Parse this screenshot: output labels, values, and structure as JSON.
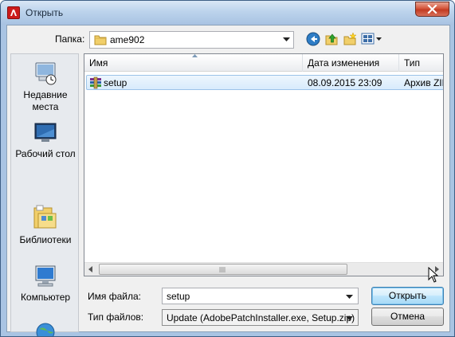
{
  "window": {
    "title": "Открыть"
  },
  "toolbar": {
    "folder_label": "Папка:",
    "current_folder": "ame902"
  },
  "places": [
    {
      "label_lines": [
        "Недавние",
        "места"
      ],
      "icon": "recent-places-icon"
    },
    {
      "label_lines": [
        "Рабочий стол"
      ],
      "icon": "desktop-icon"
    },
    {
      "label_lines": [
        "Библиотеки"
      ],
      "icon": "libraries-icon"
    },
    {
      "label_lines": [
        "Компьютер"
      ],
      "icon": "computer-icon"
    },
    {
      "label_lines": [
        ""
      ],
      "icon": "network-icon"
    }
  ],
  "filelist": {
    "columns": [
      "Имя",
      "Дата изменения",
      "Тип"
    ],
    "rows": [
      {
        "name": "setup",
        "date": "08.09.2015 23:09",
        "type": "Архив ZIP",
        "icon": "winrar-archive-icon"
      }
    ]
  },
  "bottom": {
    "filename_label": "Имя файла:",
    "filename_value": "setup",
    "filetype_label": "Тип файлов:",
    "filetype_value": "Update (AdobePatchInstaller.exe, Setup.zip)",
    "open_button": "Открыть",
    "cancel_button": "Отмена"
  },
  "colors": {
    "title_bg": "#bcd3ec",
    "close_red": "#c23b22",
    "selection": "#d7ebfc",
    "primary_border": "#3c7fb1"
  }
}
